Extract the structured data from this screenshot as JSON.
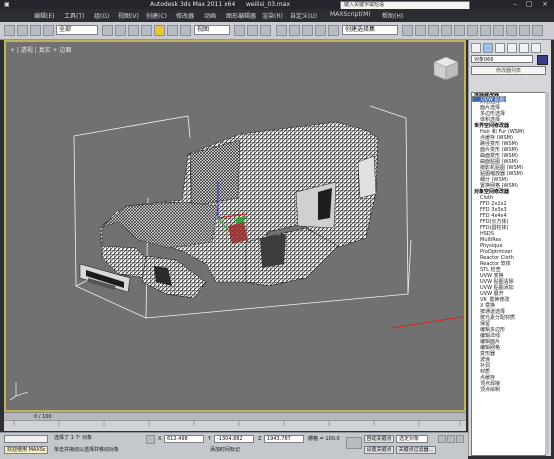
{
  "titlebar": {
    "app_title": "Autodesk 3ds Max  2011 x64",
    "file_name": "weilisi_03.max",
    "search_placeholder": "键入关键字或短语"
  },
  "menubar": {
    "items": [
      "编辑(E)",
      "工具(T)",
      "组(G)",
      "视图(V)",
      "创建(C)",
      "修改器",
      "动画",
      "图形编辑器",
      "渲染(R)",
      "自定义(U)",
      "MAXScript(M)",
      "帮助(H)"
    ]
  },
  "toolbar": {
    "selection_filter": "全部",
    "ref_coord": "视图",
    "named_selection": "创建选择集"
  },
  "viewport": {
    "label": "+ | 透视 | 真实 + 边面"
  },
  "command_panel": {
    "object_name": "对象066",
    "modifier_list": "修改器列表",
    "colors": {
      "object_swatch": "#3a3a86",
      "selected_row": "#3a66b2"
    },
    "list": [
      {
        "text": "选择修改器",
        "header": true
      },
      {
        "text": "网格选择"
      },
      {
        "text": "面片选择"
      },
      {
        "text": "多边形选择"
      },
      {
        "text": "体积选择"
      },
      {
        "text": "世界空间修改器",
        "header": true
      },
      {
        "text": "Hair 和 Fur (WSM)"
      },
      {
        "text": "点缓存 (WSM)"
      },
      {
        "text": "路径变形 (WSM)"
      },
      {
        "text": "面片变形 (WSM)"
      },
      {
        "text": "曲面变形 (WSM)"
      },
      {
        "text": "曲面贴图 (WSM)"
      },
      {
        "text": "摄影机贴图 (WSM)"
      },
      {
        "text": "贴图缩放器 (WSM)"
      },
      {
        "text": "细分 (WSM)"
      },
      {
        "text": "置换网格 (WSM)"
      },
      {
        "text": "对象空间修改器",
        "header": true
      },
      {
        "text": "Cloth"
      },
      {
        "text": "FFD 2x2x2"
      },
      {
        "text": "FFD 3x3x3"
      },
      {
        "text": "FFD 4x4x4"
      },
      {
        "text": "FFD(长方体)"
      },
      {
        "text": "FFD(圆柱体)"
      },
      {
        "text": "HSDS"
      },
      {
        "text": "MultiRes"
      },
      {
        "text": "Physique"
      },
      {
        "text": "ProOptimizer"
      },
      {
        "text": "Reactor Cloth"
      },
      {
        "text": "Reactor 软体"
      },
      {
        "text": "STL 检查"
      },
      {
        "text": "UVW 变换"
      },
      {
        "text": "UVW 贴图",
        "selected": true
      },
      {
        "text": "UVW 贴图清除"
      },
      {
        "text": "UVW 贴图添加"
      },
      {
        "text": "UVW 展开"
      },
      {
        "text": "VR_置换修改"
      },
      {
        "text": "X 变换"
      },
      {
        "text": "按通道选择"
      },
      {
        "text": "按元素分配材质"
      },
      {
        "text": "保留"
      },
      {
        "text": "编辑多边形"
      },
      {
        "text": "编辑法线"
      },
      {
        "text": "编辑面片"
      },
      {
        "text": "编辑网格"
      },
      {
        "text": "变形器"
      },
      {
        "text": "波浪"
      },
      {
        "text": "补洞"
      },
      {
        "text": "材质"
      },
      {
        "text": "点缓存"
      },
      {
        "text": "顶点焊接"
      },
      {
        "text": "顶点绘制"
      }
    ]
  },
  "timeline": {
    "frame": "0 / 100"
  },
  "status": {
    "maxscript": "欢迎使用 MAXSc",
    "selected": "选择了 1 个 对象",
    "prompt": "单击并拖动以选择并移动对象",
    "x_value": "612.498",
    "y_value": "-1304.882",
    "z_value": "1943.787",
    "grid": "栅格 = 100.0",
    "autokey": "自动关键点",
    "set_key": "设置关键点",
    "sel_obj": "选定对象",
    "key_filter": "关键点过滤器...",
    "add_time_tag": "添加时间标记"
  }
}
